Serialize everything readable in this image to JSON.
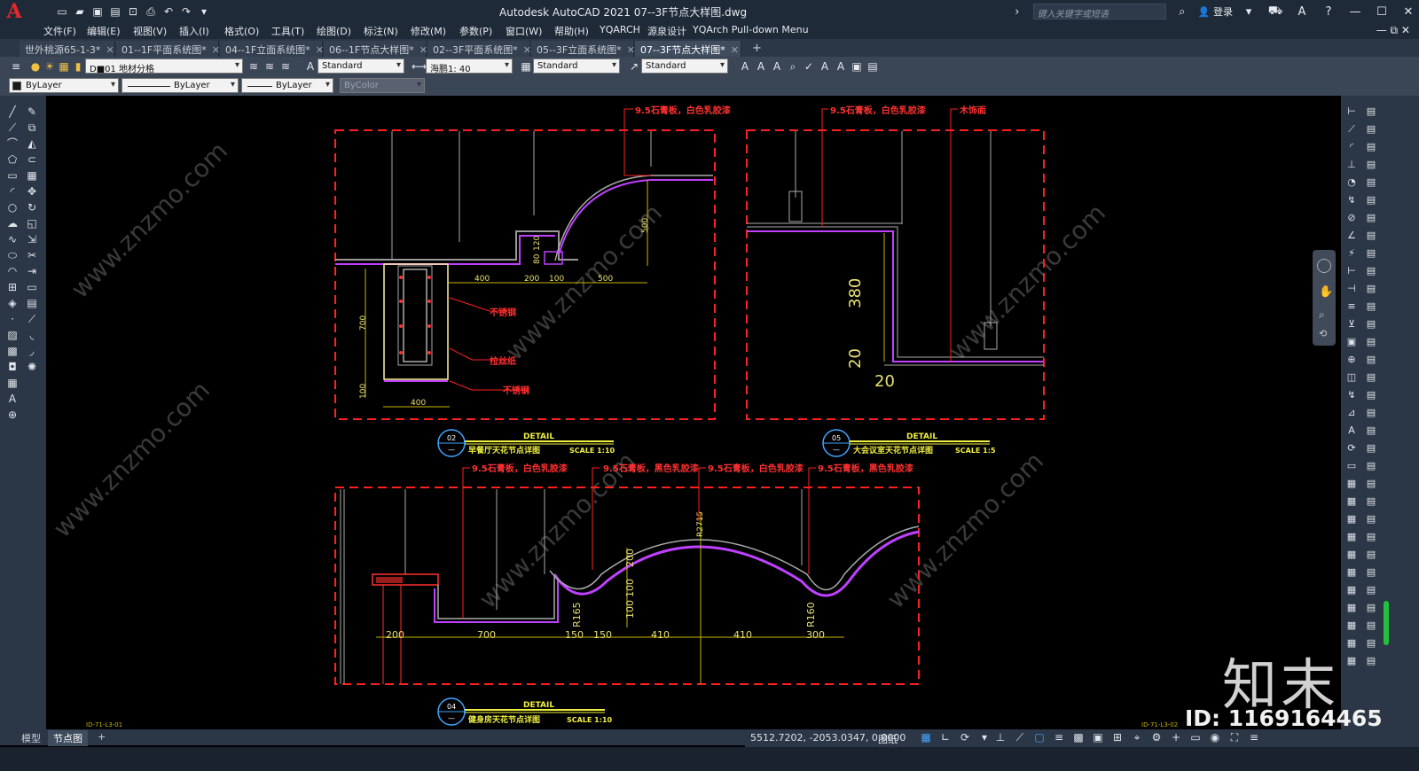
{
  "app": {
    "title": "Autodesk AutoCAD 2021    07--3F节点大样图.dwg",
    "search_placeholder": "键入关键字或短语",
    "login": "登录"
  },
  "menu": [
    "文件(F)",
    "编辑(E)",
    "视图(V)",
    "插入(I)",
    "格式(O)",
    "工具(T)",
    "绘图(D)",
    "标注(N)",
    "修改(M)",
    "参数(P)",
    "窗口(W)",
    "帮助(H)",
    "YQARCH",
    "源泉设计",
    "YQArch Pull-down Menu"
  ],
  "tabs": [
    {
      "label": "世外桃源65-1-3*",
      "active": false
    },
    {
      "label": "01--1F平面系统图*",
      "active": false
    },
    {
      "label": "04--1F立面系统图*",
      "active": false
    },
    {
      "label": "06--1F节点大样图*",
      "active": false
    },
    {
      "label": "02--3F平面系统图*",
      "active": false
    },
    {
      "label": "05--3F立面系统图*",
      "active": false
    },
    {
      "label": "07--3F节点大样图*",
      "active": true
    }
  ],
  "toolbar": {
    "layer": "D■01 地材分格",
    "text_style": "Standard",
    "dim_style": "海鹏1: 40",
    "table_style": "Standard",
    "mleader_style": "Standard",
    "color": "ByLayer",
    "linetype": "ByLayer",
    "lineweight": "ByLayer",
    "plotstyle": "ByColor"
  },
  "drawing": {
    "detail02": {
      "labels": [
        "9.5石膏板，白色乳胶漆",
        "不锈钢",
        "拉丝纸",
        "不锈钢"
      ],
      "dims": [
        "400",
        "200",
        "100",
        "500",
        "700",
        "400",
        "500",
        "80",
        "120",
        "100"
      ],
      "tag_num": "02",
      "tag_title": "DETAIL",
      "tag_name": "早餐厅天花节点详图",
      "tag_scale": "SCALE 1:10"
    },
    "detail05": {
      "labels": [
        "9.5石膏板，白色乳胶漆",
        "木饰面"
      ],
      "dims": [
        "380",
        "20",
        "20"
      ],
      "tag_num": "05",
      "tag_title": "DETAIL",
      "tag_name": "大会议室天花节点详图",
      "tag_scale": "SCALE 1:5"
    },
    "detail04": {
      "labels": [
        "9.5石膏板，白色乳胶漆",
        "9.5石膏板，黑色乳胶漆",
        "9.5石膏板，白色乳胶漆",
        "9.5石膏板，黑色乳胶漆"
      ],
      "dims": [
        "200",
        "700",
        "150",
        "150",
        "410",
        "410",
        "300",
        "R165",
        "R160",
        "R2715",
        "200",
        "100",
        "100"
      ],
      "tag_num": "04",
      "tag_title": "DETAIL",
      "tag_name": "健身房天花节点详图",
      "tag_scale": "SCALE 1:10"
    },
    "corner_left": "ID-71-L3-01",
    "corner_right": "ID-71-L3-02",
    "watermark": "www.znzmo.com"
  },
  "model_tabs": [
    {
      "label": "模型",
      "active": false
    },
    {
      "label": "节点图",
      "active": true
    }
  ],
  "status": {
    "coords": "5512.7202, -2053.0347, 0.0000",
    "space": "图纸"
  },
  "brand": {
    "name": "知末",
    "id": "ID: 1169164465"
  }
}
